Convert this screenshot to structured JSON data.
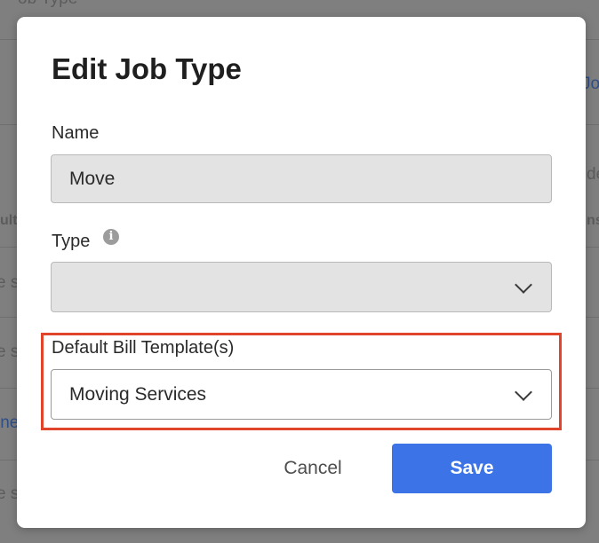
{
  "background": {
    "top_fragment": "ob Type",
    "right_link": "Jo",
    "right_text_1": "de",
    "right_text_2": "ns",
    "left_text_1": "ult",
    "left_text_2": "e s",
    "left_text_3": "e s",
    "left_link": "ine",
    "left_text_4": "e s"
  },
  "modal": {
    "title": "Edit Job Type",
    "name": {
      "label": "Name",
      "value": "Move"
    },
    "type": {
      "label": "Type",
      "info_icon": "info-icon",
      "value": ""
    },
    "bill_template": {
      "label": "Default Bill Template(s)",
      "value": "Moving Services"
    },
    "cancel_label": "Cancel",
    "save_label": "Save"
  },
  "colors": {
    "primary": "#3c73e6",
    "highlight": "#e0452b",
    "disabled_field": "#e3e3e3"
  }
}
